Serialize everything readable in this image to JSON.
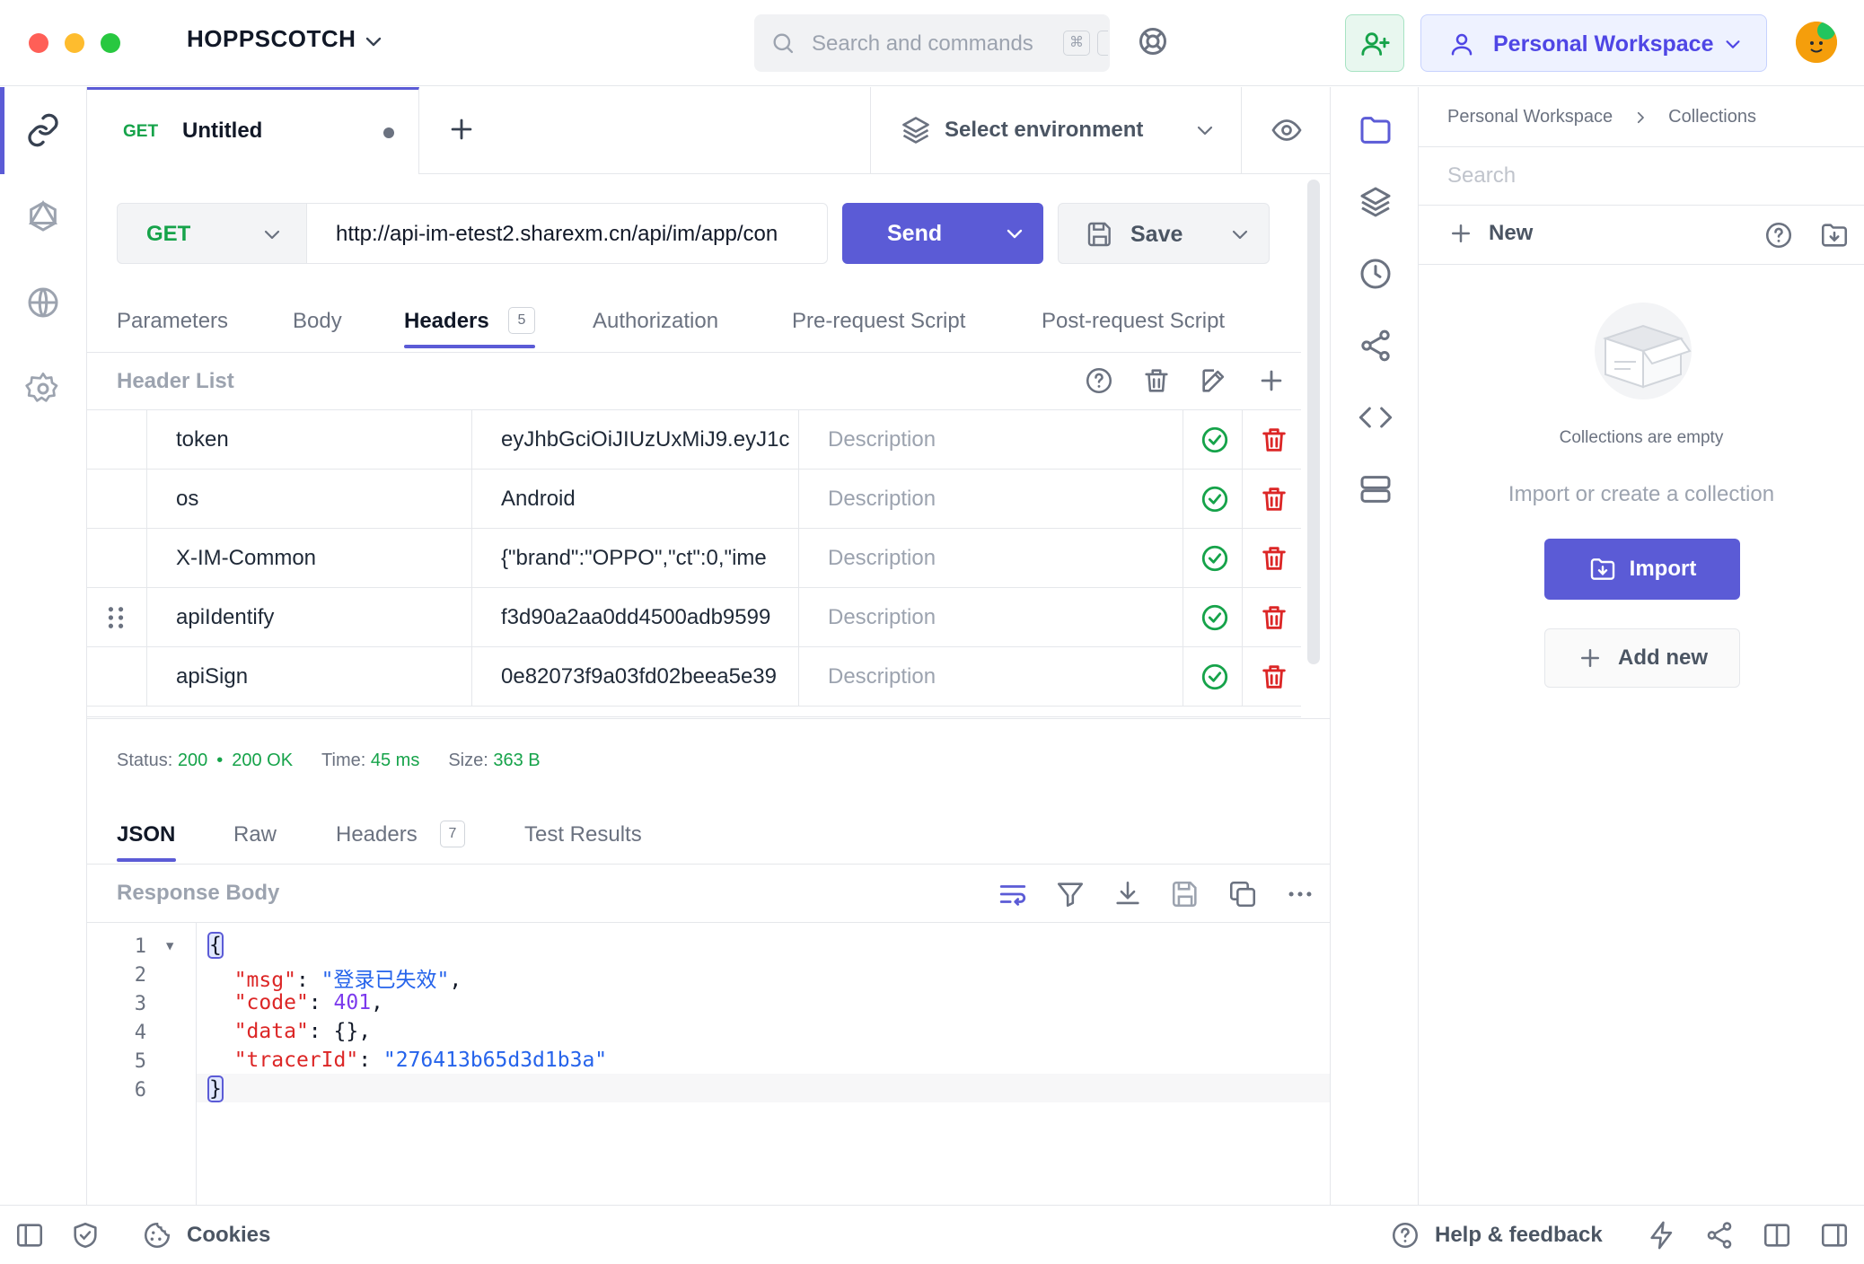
{
  "app": {
    "name": "HOPPSCOTCH"
  },
  "search": {
    "placeholder": "Search and commands",
    "shortcut": "⌘"
  },
  "workspace": {
    "label": "Personal Workspace"
  },
  "tab": {
    "method": "GET",
    "title": "Untitled"
  },
  "environment": {
    "label": "Select environment"
  },
  "request": {
    "method": "GET",
    "url": "http://api-im-etest2.sharexm.cn/api/im/app/con",
    "send_label": "Send",
    "save_label": "Save"
  },
  "request_tabs": [
    {
      "label": "Parameters"
    },
    {
      "label": "Body"
    },
    {
      "label": "Headers",
      "count": "5"
    },
    {
      "label": "Authorization"
    },
    {
      "label": "Pre-request Script"
    },
    {
      "label": "Post-request Script"
    }
  ],
  "header_list": {
    "title": "Header List",
    "rows": [
      {
        "key": "token",
        "value": "eyJhbGciOiJIUzUxMiJ9.eyJ1c",
        "description": "Description"
      },
      {
        "key": "os",
        "value": "Android",
        "description": "Description"
      },
      {
        "key": "X-IM-Common",
        "value": "{\"brand\":\"OPPO\",\"ct\":0,\"ime",
        "description": "Description"
      },
      {
        "key": "apiIdentify",
        "value": "f3d90a2aa0dd4500adb9599",
        "description": "Description"
      },
      {
        "key": "apiSign",
        "value": "0e82073f9a03fd02beea5e39",
        "description": "Description"
      }
    ]
  },
  "response": {
    "status_label": "Status:",
    "status_code": "200",
    "status_text": "200 OK",
    "time_label": "Time:",
    "time_value": "45 ms",
    "size_label": "Size:",
    "size_value": "363 B",
    "tabs": [
      {
        "label": "JSON"
      },
      {
        "label": "Raw"
      },
      {
        "label": "Headers",
        "count": "7"
      },
      {
        "label": "Test Results"
      }
    ],
    "body_title": "Response Body",
    "line_numbers": [
      "1",
      "2",
      "3",
      "4",
      "5",
      "6"
    ],
    "json": {
      "open": "{",
      "close": "}",
      "lines": [
        {
          "key": "\"msg\"",
          "value": "\"登录已失效\"",
          "type": "string",
          "trail": ","
        },
        {
          "key": "\"code\"",
          "value": "401",
          "type": "number",
          "trail": ","
        },
        {
          "key": "\"data\"",
          "value": "{}",
          "type": "object",
          "trail": ","
        },
        {
          "key": "\"tracerId\"",
          "value": "\"276413b65d3d1b3a\"",
          "type": "string",
          "trail": ""
        }
      ]
    }
  },
  "collections": {
    "breadcrumb": [
      "Personal Workspace",
      "Collections"
    ],
    "search_placeholder": "Search",
    "new_label": "New",
    "empty_text": "Collections are empty",
    "prompt": "Import or create a collection",
    "import_label": "Import",
    "add_new_label": "Add new"
  },
  "footer": {
    "cookies": "Cookies",
    "help": "Help & feedback"
  },
  "colors": {
    "accent": "#5b5bd6",
    "success": "#16a34a",
    "danger": "#dc2626"
  }
}
